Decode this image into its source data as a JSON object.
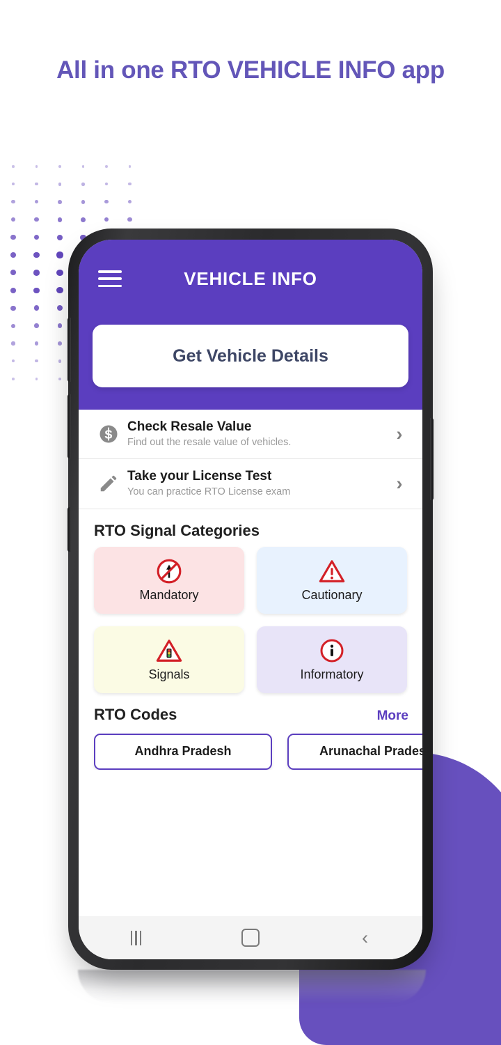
{
  "page": {
    "headline": "All in one RTO VEHICLE INFO app",
    "headline_color": "#6356B8",
    "background_color": "#FFFFFF",
    "blob_color": "#6750BE",
    "dot_color": "#5B3EB8"
  },
  "app": {
    "brand_color": "#5B3EBF",
    "appbar": {
      "menu_icon": "hamburger-menu-icon",
      "title": "VEHICLE INFO"
    },
    "cta": {
      "label": "Get Vehicle Details",
      "text_color": "#3D4665"
    },
    "list_rows": [
      {
        "icon": "dollar-coin-icon",
        "title": "Check Resale Value",
        "subtitle": "Find out the resale value of vehicles.",
        "chevron": "chevron-right-icon"
      },
      {
        "icon": "pencil-icon",
        "title": "Take your License Test",
        "subtitle": "You can practice RTO License exam",
        "chevron": "chevron-right-icon"
      }
    ],
    "signal_section": {
      "title": "RTO Signal Categories",
      "cards": [
        {
          "label": "Mandatory",
          "icon": "no-straight-ahead-sign-icon",
          "bg": "#FCE3E4"
        },
        {
          "label": "Cautionary",
          "icon": "warning-triangle-icon",
          "bg": "#E8F2FE"
        },
        {
          "label": "Signals",
          "icon": "traffic-light-warning-icon",
          "bg": "#FBFBE4"
        },
        {
          "label": "Informatory",
          "icon": "info-circle-icon",
          "bg": "#E8E4F8"
        }
      ]
    },
    "codes_section": {
      "title": "RTO Codes",
      "more_label": "More",
      "chips": [
        {
          "label": "Andhra Pradesh"
        },
        {
          "label": "Arunachal Pradesh"
        }
      ]
    },
    "navbar": {
      "recents_label": "recents-icon",
      "home_label": "home-icon",
      "back_label": "back-icon"
    }
  }
}
